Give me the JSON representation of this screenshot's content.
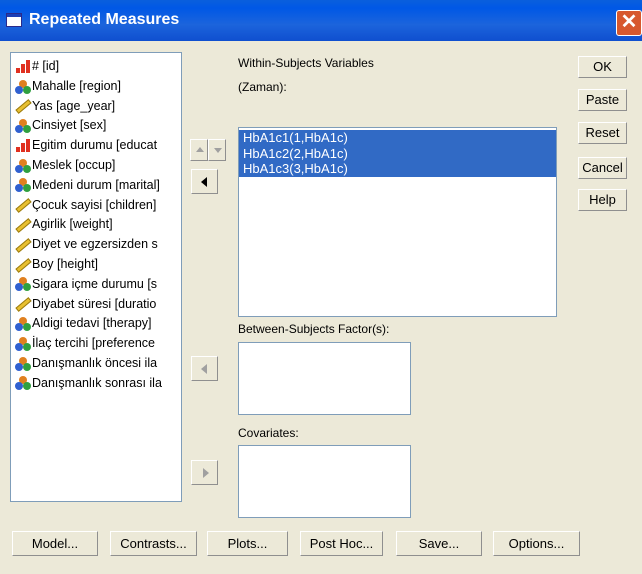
{
  "window": {
    "title": "Repeated Measures"
  },
  "variables": [
    {
      "label": "# [id]",
      "icon": "ordinal-icon"
    },
    {
      "label": "Mahalle [region]",
      "icon": "nominal-icon"
    },
    {
      "label": "Yas [age_year]",
      "icon": "scale-icon"
    },
    {
      "label": "Cinsiyet [sex]",
      "icon": "nominal-icon"
    },
    {
      "label": "Egitim durumu [educat",
      "icon": "ordinal-icon"
    },
    {
      "label": "Meslek [occup]",
      "icon": "nominal-icon"
    },
    {
      "label": "Medeni durum [marital]",
      "icon": "nominal-icon"
    },
    {
      "label": "Çocuk sayisi [children]",
      "icon": "scale-icon"
    },
    {
      "label": "Agirlik [weight]",
      "icon": "scale-icon"
    },
    {
      "label": "Diyet ve egzersizden s",
      "icon": "scale-icon"
    },
    {
      "label": "Boy [height]",
      "icon": "scale-icon"
    },
    {
      "label": "Sigara içme durumu [s",
      "icon": "nominal-icon"
    },
    {
      "label": "Diyabet süresi [duratio",
      "icon": "scale-icon"
    },
    {
      "label": "Aldigi tedavi [therapy]",
      "icon": "nominal-icon"
    },
    {
      "label": "İlaç tercihi [preference",
      "icon": "nominal-icon"
    },
    {
      "label": "Danışmanlık öncesi ila",
      "icon": "nominal-icon"
    },
    {
      "label": "Danışmanlık sonrası ila",
      "icon": "nominal-icon"
    }
  ],
  "within": {
    "label": "Within-Subjects Variables",
    "factor": "(Zaman):",
    "items": [
      "HbA1c1(1,HbA1c)",
      "HbA1c2(2,HbA1c)",
      "HbA1c3(3,HbA1c)"
    ]
  },
  "between": {
    "label": "Between-Subjects Factor(s):"
  },
  "covariates": {
    "label": "Covariates:"
  },
  "side_buttons": {
    "ok": "OK",
    "paste": "Paste",
    "reset": "Reset",
    "cancel": "Cancel",
    "help": "Help"
  },
  "bottom_buttons": {
    "model": "Model...",
    "contrasts": "Contrasts...",
    "plots": "Plots...",
    "post_hoc": "Post Hoc...",
    "save": "Save...",
    "options": "Options..."
  },
  "colors": {
    "titlebar": "#0058e6",
    "selection": "#316ac5",
    "dialog": "#ece9d8"
  }
}
